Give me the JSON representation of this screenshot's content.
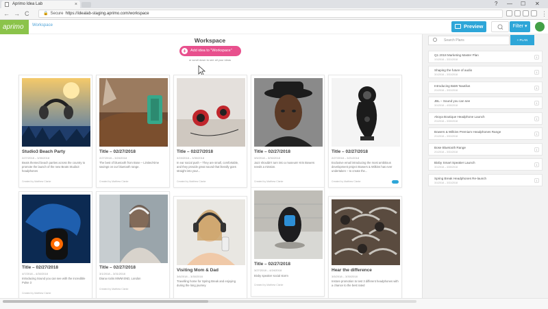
{
  "browser": {
    "tab_title": "Aprimo Idea Lab",
    "tab_close": "×",
    "window_controls": [
      "?",
      "—",
      "☐",
      "✕"
    ],
    "secure_label": "Secure",
    "url": "https://idealab-staging.aprimo.com/workspace",
    "nav": [
      "←",
      "→",
      "C"
    ]
  },
  "header": {
    "logo": "aprimo",
    "workspace_link": "Workspace",
    "preview_label": "Preview",
    "filter_label": "Filter ▾"
  },
  "workspace": {
    "title": "Workspace",
    "add_idea_label": "Add idea to \"Workspace\"",
    "add_idea_plus": "+",
    "scroll_hint": "or scroll down to see all your ideas"
  },
  "cards": [
    {
      "title": "Studio3 Beach Party",
      "date": "2/27/2018 – 3/30/2018",
      "text": "Beats themed beach parties across the country to promote the launch of the new Beats Studio3 headphones",
      "by": "Created by Matthew Clarke"
    },
    {
      "title": "Title – 02/27/2018",
      "date": "2/27/2018 – 3/24/2018",
      "text": "The best of bluetooth from Bose – Limited-time savings on our bluetooth range.",
      "by": "Created by Matthew Clarke"
    },
    {
      "title": "Title – 02/27/2018",
      "date": "3/19/2018 – 3/30/2018",
      "text": "In ear social push – They are small, comfortable, and they provide great sound that literally goes straight into your...",
      "by": "Created by Matthew Clarke"
    },
    {
      "title": "Title – 02/27/2018",
      "date": "3/5/2018 – 3/30/2018",
      "text": "Jazz shouldn't turn into a museum! Kris Bowers needs a mission.",
      "by": "Created by Matthew Clarke"
    },
    {
      "title": "Title – 02/27/2018",
      "date": "2/27/2018 – 3/21/2018",
      "text": "Exclusive email introducing the most ambitious development project Bowers & Wilkins has ever undertaken – to create the...",
      "by": "Created by Matthew Clarke"
    },
    {
      "title": "Title – 02/27/2018",
      "date": "4/7/2018 – 4/30/2018",
      "text": "Introducing Sound you can see with the incredible Pulse 3",
      "by": "Created by Matthew Clarke"
    },
    {
      "title": "Title – 02/27/2018",
      "date": "3/1/2018 – 3/31/2018",
      "text": "Diana rocks MWM END, London",
      "by": "Created by Matthew Clarke"
    },
    {
      "title": "Visiting Mom & Dad",
      "date": "3/6/2018 – 3/30/2018",
      "text": "Travelling home for Spring Break and enjoying during the long journey",
      "by": ""
    },
    {
      "title": "Title – 02/27/2018",
      "date": "3/27/2018 – 4/24/2018",
      "text": "Bixby speaker social storm",
      "by": "Created by Matthew Clarke"
    },
    {
      "title": "Hear the difference",
      "date": "3/5/2018 – 3/30/2018",
      "text": "Instore promotion to test 3 different headphones with a chance to the best rated",
      "by": ""
    }
  ],
  "plans_panel": {
    "search_placeholder": "Search Plans",
    "add_plan_label": "+ PLAN",
    "plans": [
      {
        "name": "Q1 2018 Marketing Master Plan",
        "dates": "1/1/2018 – 3/31/2018",
        "count": "1"
      },
      {
        "name": "Shaping the future of audio",
        "dates": "3/1/2018 – 3/31/2018",
        "count": "1"
      },
      {
        "name": "Introducing B&W Nautilus",
        "dates": "2/1/2018 – 3/31/2018",
        "count": "4"
      },
      {
        "name": "JBL – Sound you can see",
        "dates": "3/1/2018 – 4/30/2018",
        "count": "1"
      },
      {
        "name": "Akoya Boutique Headphone Launch",
        "dates": "2/1/2018 – 3/30/2018",
        "count": "1"
      },
      {
        "name": "Bowers & Wilkins Premium Headphones Range",
        "dates": "2/1/2018 – 3/31/2018",
        "count": "1"
      },
      {
        "name": "Bose Bluetooth Range",
        "dates": "2/1/2018 – 3/31/2018",
        "count": "1"
      },
      {
        "name": "Bixby Smart Speaker Launch",
        "dates": "3/1/2018 – 4/30/2018",
        "count": "1"
      },
      {
        "name": "Spring Break Headphones Re-launch",
        "dates": "3/1/2018 – 3/31/2018",
        "count": "1"
      }
    ]
  },
  "colors": {
    "accent": "#2ea6d8",
    "brand_green": "#8bc34a",
    "add_idea_pink": "#e8508d"
  }
}
